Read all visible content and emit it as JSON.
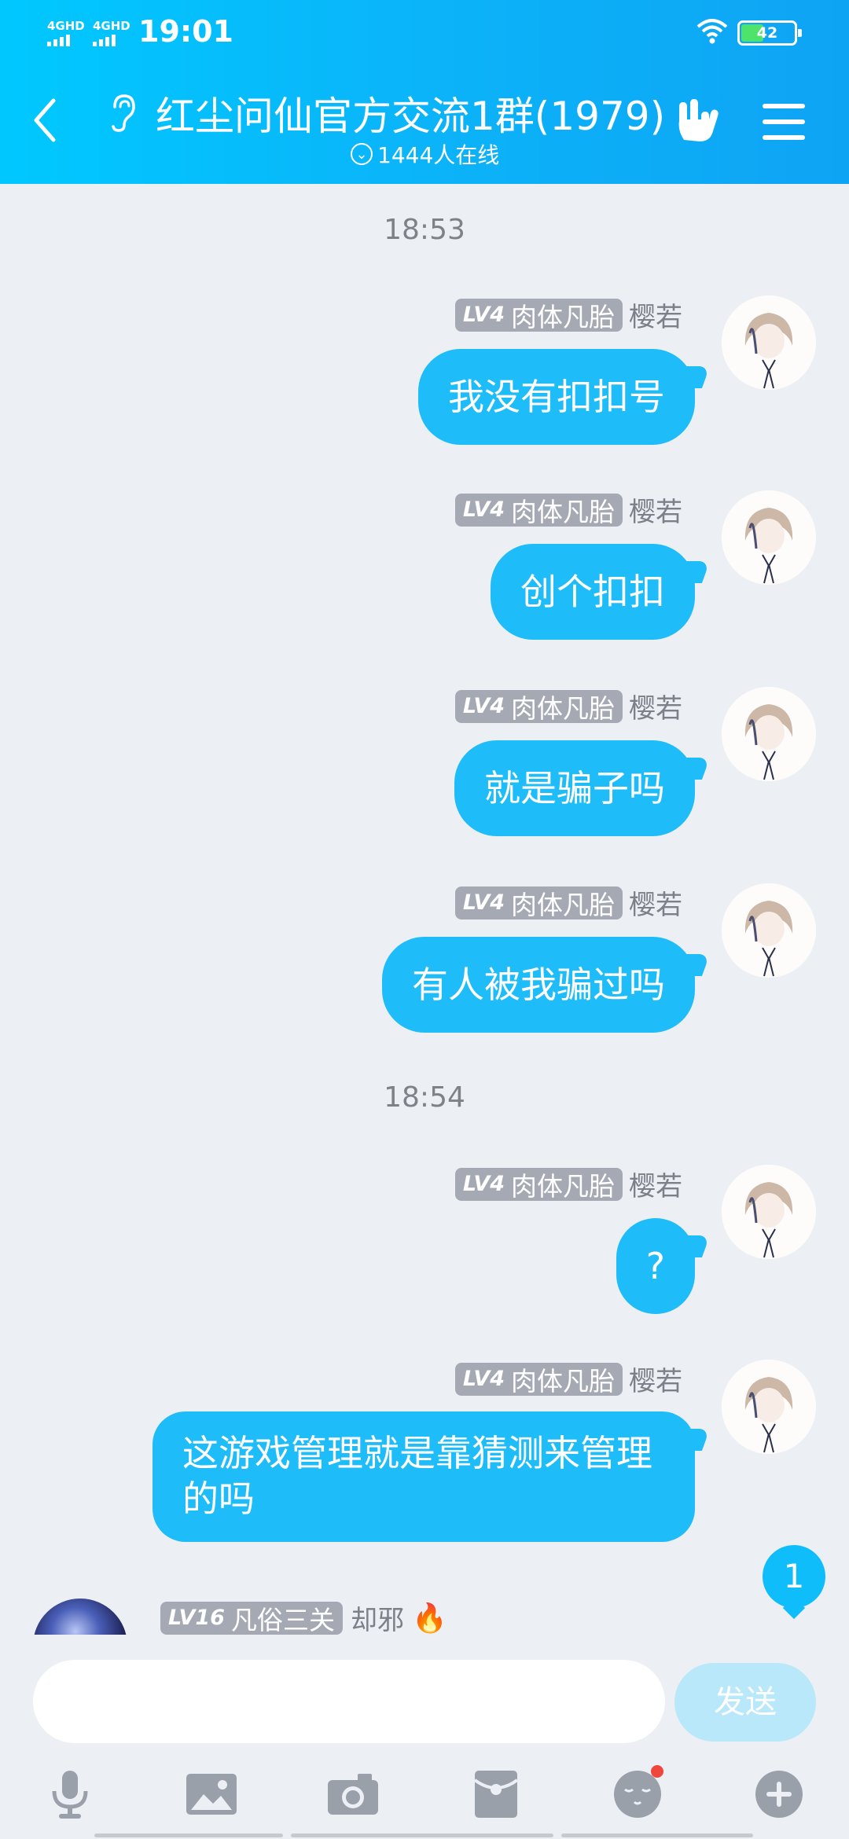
{
  "status_bar": {
    "network1": "4GHD",
    "network2": "4GHD",
    "time": "19:01",
    "battery": "42"
  },
  "header": {
    "title": "红尘问仙官方交流1群(1979)",
    "online": "1444人在线"
  },
  "messages": [
    {
      "type": "time",
      "text": "18:53"
    },
    {
      "type": "self",
      "level": "LV4",
      "rank": "肉体凡胎",
      "name": "樱若",
      "text": "我没有扣扣号"
    },
    {
      "type": "self",
      "level": "LV4",
      "rank": "肉体凡胎",
      "name": "樱若",
      "text": "创个扣扣"
    },
    {
      "type": "self",
      "level": "LV4",
      "rank": "肉体凡胎",
      "name": "樱若",
      "text": "就是骗子吗"
    },
    {
      "type": "self",
      "level": "LV4",
      "rank": "肉体凡胎",
      "name": "樱若",
      "text": "有人被我骗过吗"
    },
    {
      "type": "time",
      "text": "18:54"
    },
    {
      "type": "self",
      "level": "LV4",
      "rank": "肉体凡胎",
      "name": "樱若",
      "text": "?"
    },
    {
      "type": "self",
      "level": "LV4",
      "rank": "肉体凡胎",
      "name": "樱若",
      "text": "这游戏管理就是靠猜测来管理的吗"
    },
    {
      "type": "other",
      "level": "LV16",
      "rank": "凡俗三关",
      "name": "却邪"
    }
  ],
  "unread_count": "1",
  "composer": {
    "placeholder": "",
    "send_label": "发送"
  },
  "toolbar": [
    "microphone-icon",
    "image-icon",
    "camera-icon",
    "red-packet-icon",
    "emoji-icon",
    "plus-icon"
  ],
  "colors": {
    "header_start": "#00c8ff",
    "bubble": "#1ebcf8",
    "send_disabled": "#b9e8fb",
    "level_badge": "#a5a9b4"
  }
}
